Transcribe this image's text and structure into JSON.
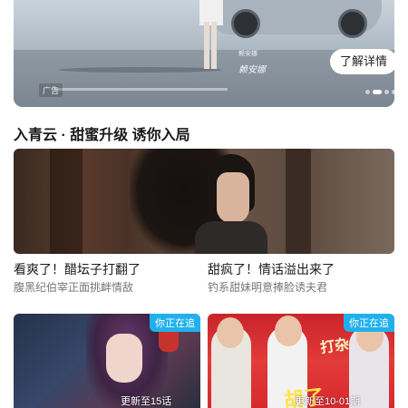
{
  "ad": {
    "badge": "广告",
    "cta": "了解详情",
    "endorser_name": "赖安娜",
    "signature": "赖安娜",
    "slide_count": 5,
    "active_slide": 2
  },
  "section": {
    "title": "入青云 · 甜蜜升级 诱你入局"
  },
  "featured": {
    "items": [
      {
        "title": "看爽了！醋坛子打翻了",
        "subtitle": "腹黑纪伯宰正面挑衅情敌"
      },
      {
        "title": "甜疯了！情话溢出来了",
        "subtitle": "钓系甜妹明意捧脸诱夫君"
      }
    ]
  },
  "cards": [
    {
      "tag": "你正在追",
      "update": "更新至15话"
    },
    {
      "tag": "你正在追",
      "update": "更新至10-01期",
      "poster_text_1": "打杂",
      "poster_text_2": "胡了"
    }
  ],
  "colors": {
    "accent": "#20b1ec",
    "title_text": "#1a1a1a",
    "subtitle_text": "#777777"
  }
}
